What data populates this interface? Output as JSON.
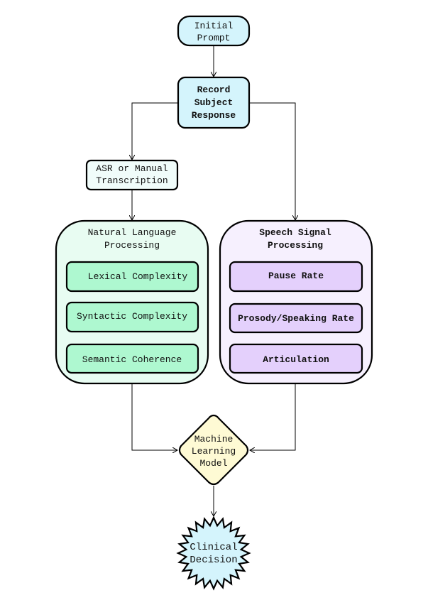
{
  "nodes": {
    "initial_prompt": {
      "lines": [
        "Initial",
        "Prompt"
      ]
    },
    "record": {
      "lines": [
        "Record",
        "Subject",
        "Response"
      ]
    },
    "asr": {
      "lines": [
        "ASR or Manual",
        "Transcription"
      ]
    },
    "nlp": {
      "title": [
        "Natural Language",
        "Processing"
      ],
      "items": [
        "Lexical Complexity",
        "Syntactic Complexity",
        "Semantic Coherence"
      ]
    },
    "speech": {
      "title": [
        "Speech Signal",
        "Processing"
      ],
      "items": [
        "Pause Rate",
        "Prosody/Speaking Rate",
        "Articulation"
      ]
    },
    "ml": {
      "lines": [
        "Machine",
        "Learning",
        "Model"
      ]
    },
    "decision": {
      "lines": [
        "Clinical",
        "Decision"
      ]
    }
  },
  "colors": {
    "blue": "#d4f4fc",
    "green_bg": "#e8fcf2",
    "green": "#aef8d0",
    "purple_bg": "#f6f0fe",
    "purple": "#e4d0fc",
    "yellow": "#fefad4"
  }
}
